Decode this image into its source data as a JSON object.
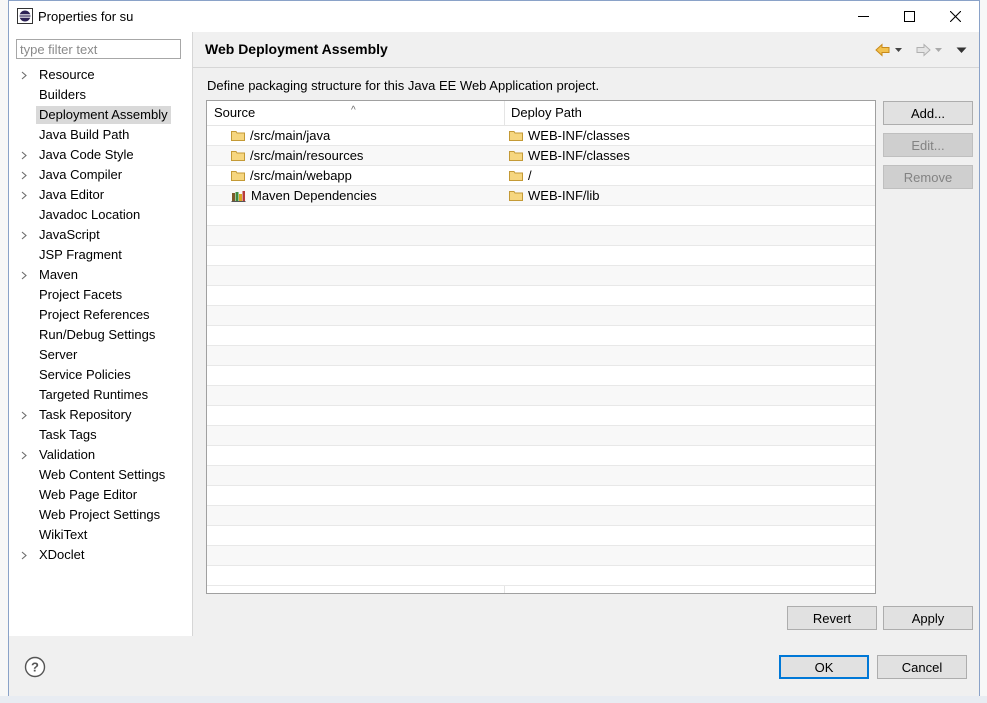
{
  "window": {
    "title": "Properties for su",
    "controls": [
      "minimize-icon",
      "maximize-icon",
      "close-icon"
    ]
  },
  "filter": {
    "placeholder": "type filter text",
    "value": ""
  },
  "tree": {
    "items": [
      {
        "label": "Resource",
        "expandable": true,
        "selected": false
      },
      {
        "label": "Builders",
        "expandable": false,
        "selected": false
      },
      {
        "label": "Deployment Assembly",
        "expandable": false,
        "selected": true
      },
      {
        "label": "Java Build Path",
        "expandable": false,
        "selected": false
      },
      {
        "label": "Java Code Style",
        "expandable": true,
        "selected": false
      },
      {
        "label": "Java Compiler",
        "expandable": true,
        "selected": false
      },
      {
        "label": "Java Editor",
        "expandable": true,
        "selected": false
      },
      {
        "label": "Javadoc Location",
        "expandable": false,
        "selected": false
      },
      {
        "label": "JavaScript",
        "expandable": true,
        "selected": false
      },
      {
        "label": "JSP Fragment",
        "expandable": false,
        "selected": false
      },
      {
        "label": "Maven",
        "expandable": true,
        "selected": false
      },
      {
        "label": "Project Facets",
        "expandable": false,
        "selected": false
      },
      {
        "label": "Project References",
        "expandable": false,
        "selected": false
      },
      {
        "label": "Run/Debug Settings",
        "expandable": false,
        "selected": false
      },
      {
        "label": "Server",
        "expandable": false,
        "selected": false
      },
      {
        "label": "Service Policies",
        "expandable": false,
        "selected": false
      },
      {
        "label": "Targeted Runtimes",
        "expandable": false,
        "selected": false
      },
      {
        "label": "Task Repository",
        "expandable": true,
        "selected": false
      },
      {
        "label": "Task Tags",
        "expandable": false,
        "selected": false
      },
      {
        "label": "Validation",
        "expandable": true,
        "selected": false
      },
      {
        "label": "Web Content Settings",
        "expandable": false,
        "selected": false
      },
      {
        "label": "Web Page Editor",
        "expandable": false,
        "selected": false
      },
      {
        "label": "Web Project Settings",
        "expandable": false,
        "selected": false
      },
      {
        "label": "WikiText",
        "expandable": false,
        "selected": false
      },
      {
        "label": "XDoclet",
        "expandable": true,
        "selected": false
      }
    ]
  },
  "page": {
    "title": "Web Deployment Assembly",
    "description": "Define packaging structure for this Java EE Web Application project."
  },
  "table": {
    "columns": [
      "Source",
      "Deploy Path"
    ],
    "rows": [
      {
        "source": "/src/main/java",
        "source_icon": "folder-icon",
        "deploy": "WEB-INF/classes"
      },
      {
        "source": "/src/main/resources",
        "source_icon": "folder-icon",
        "deploy": "WEB-INF/classes"
      },
      {
        "source": "/src/main/webapp",
        "source_icon": "folder-icon",
        "deploy": "/"
      },
      {
        "source": "Maven Dependencies",
        "source_icon": "library-icon",
        "deploy": "WEB-INF/lib"
      }
    ]
  },
  "buttons": {
    "add": "Add...",
    "edit": "Edit...",
    "remove": "Remove",
    "revert": "Revert",
    "apply": "Apply",
    "ok": "OK",
    "cancel": "Cancel"
  },
  "colors": {
    "selection": "#d9d9d9",
    "default_button_border": "#0078d7",
    "folder": "#dcb35c",
    "nav_back": "#e8a33d"
  }
}
